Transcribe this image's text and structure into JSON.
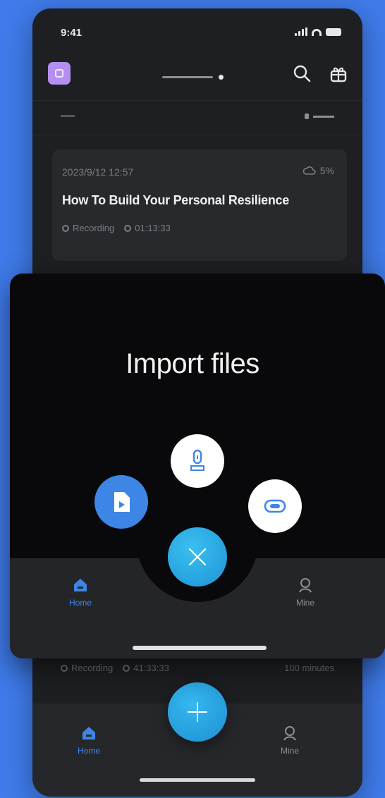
{
  "status_bar": {
    "time": "9:41"
  },
  "header": {
    "workspace_dot": "•"
  },
  "recording_card": {
    "date": "2023/9/12 12:57",
    "progress": "5%",
    "title": "How To Build Your Personal Resilience",
    "type": "Recording",
    "duration": "01:13:33"
  },
  "second_item": {
    "type": "Recording",
    "duration": "41:33:33",
    "extra": "100 minutes"
  },
  "tabbar": {
    "home_label": "Home",
    "mine_label": "Mine"
  },
  "import_sheet": {
    "title": "Import files",
    "options": [
      "file-icon",
      "voice-recorder-icon",
      "cloud-link-icon"
    ],
    "close_icon": "close-icon"
  },
  "colors": {
    "accent_blue": "#3e86e6",
    "fab_cyan": "#1f8fd3",
    "background": "#3f7bea"
  }
}
